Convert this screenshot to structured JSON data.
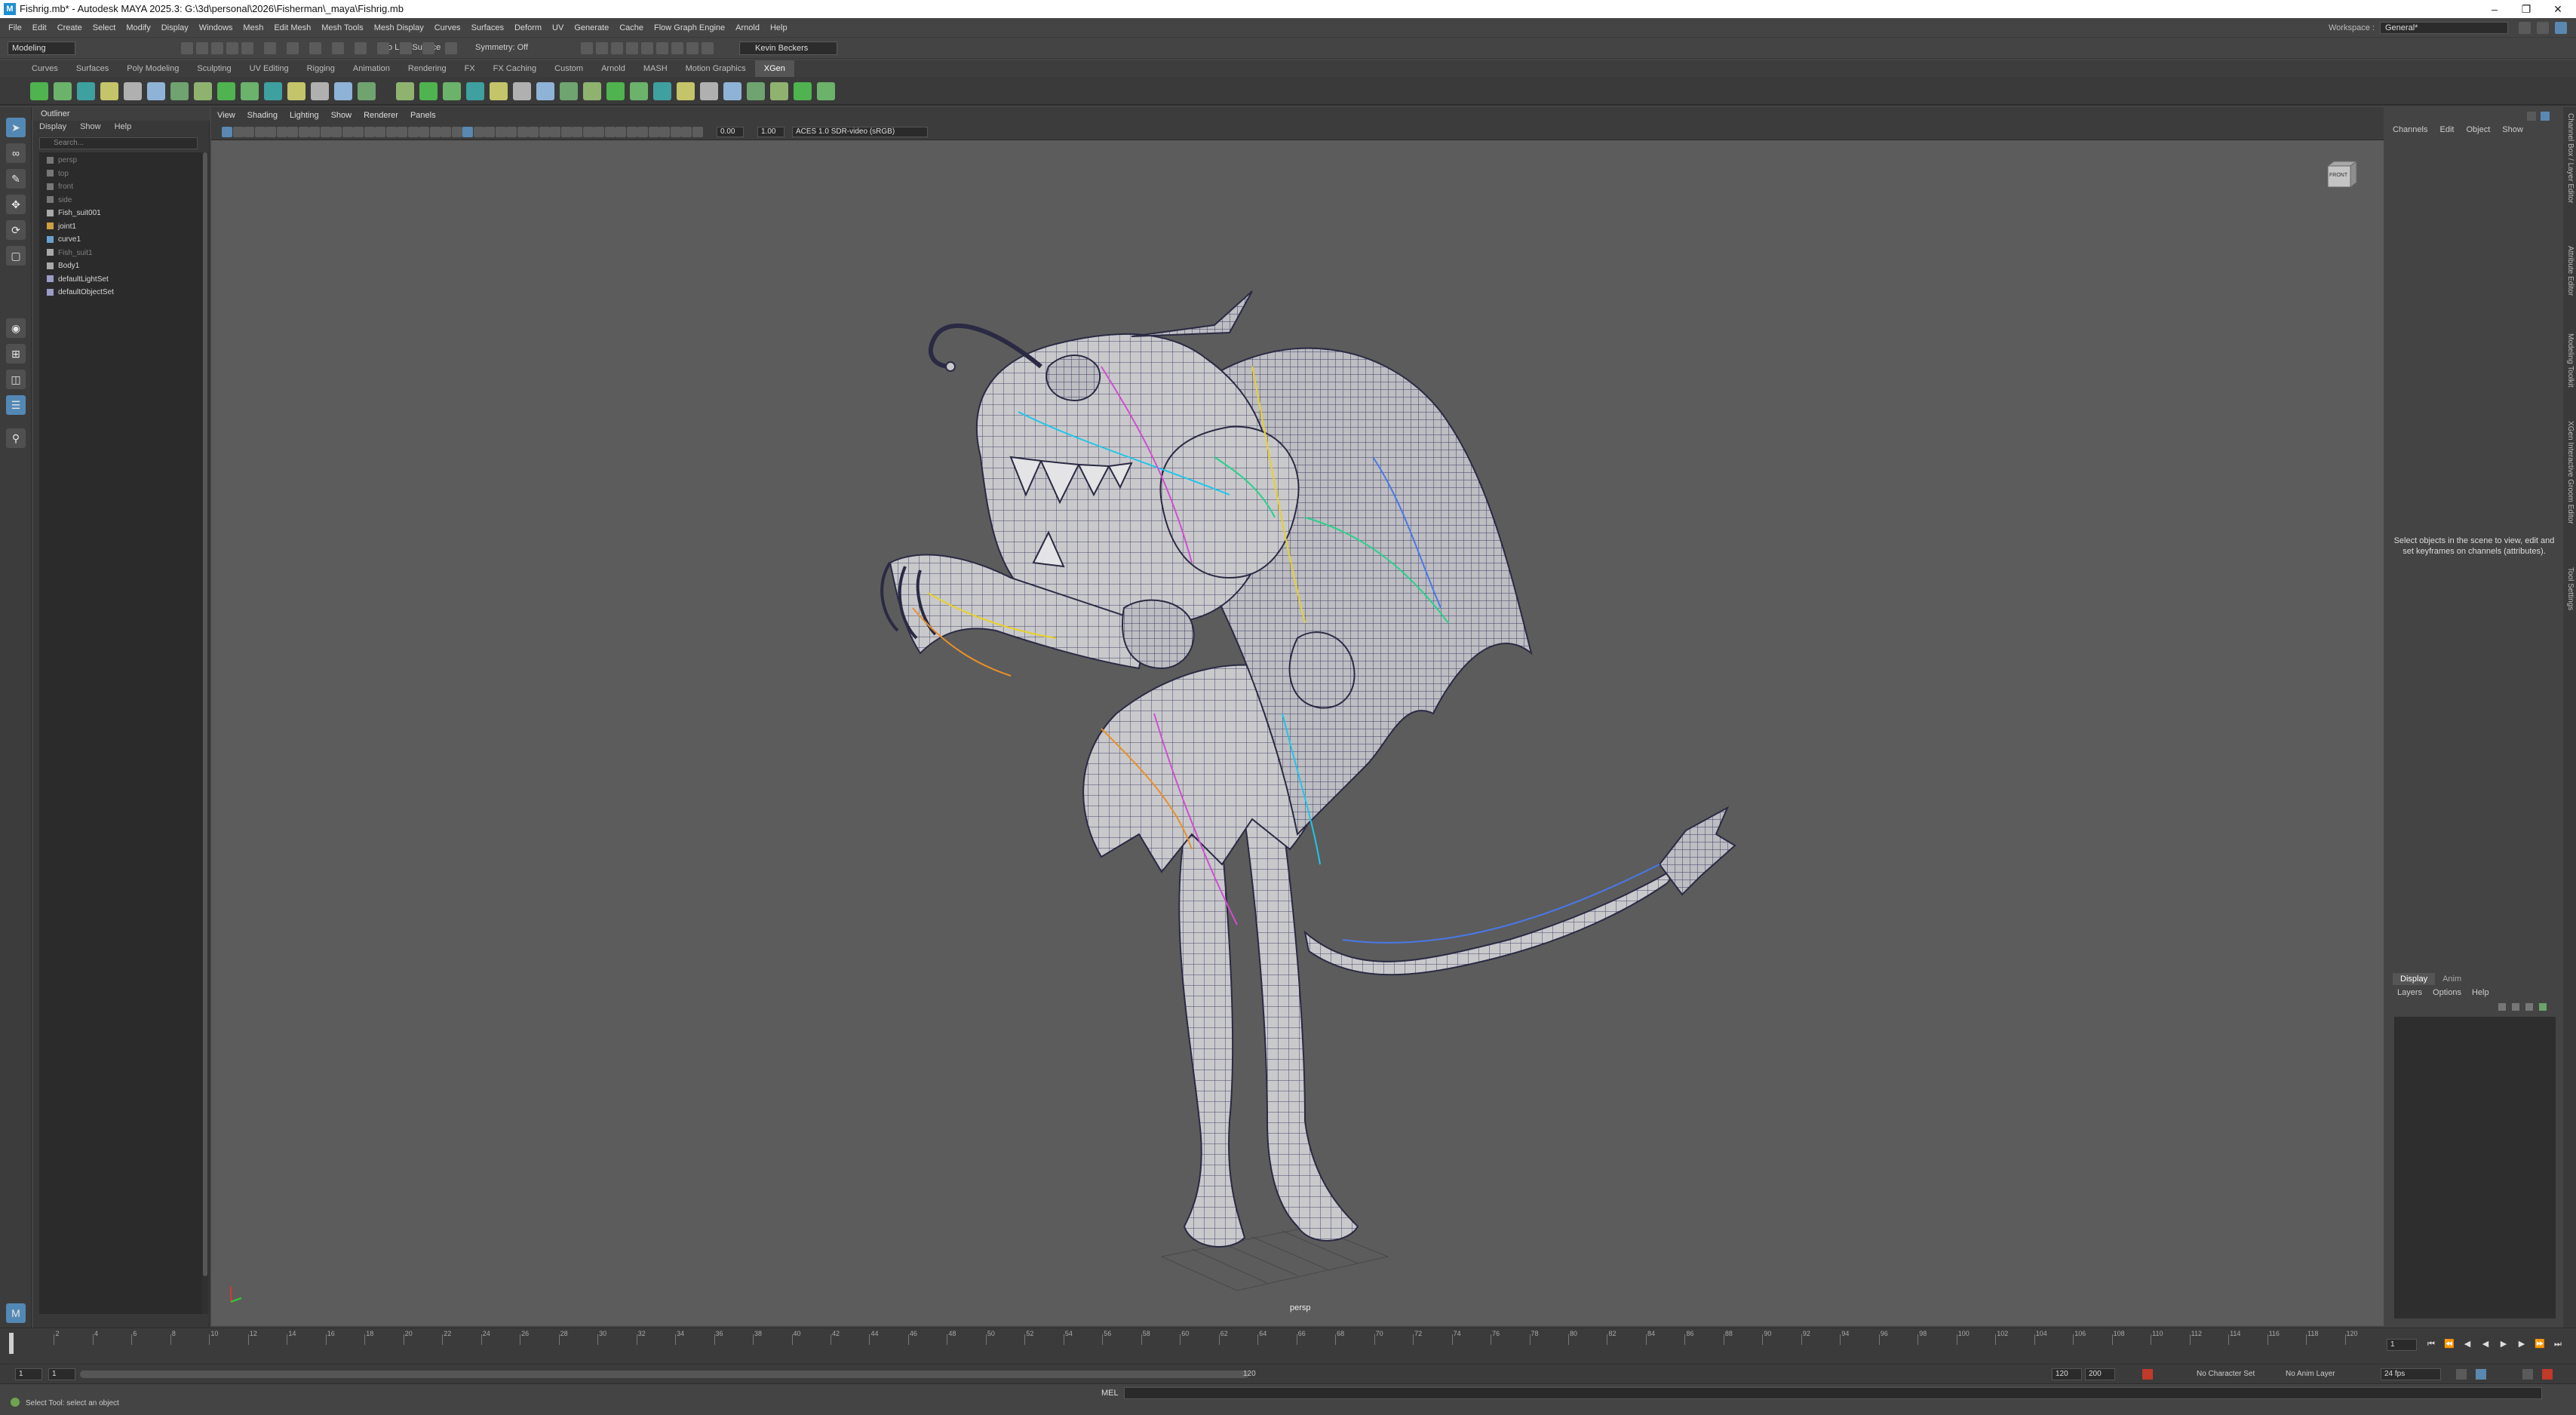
{
  "window": {
    "title": "Fishrig.mb* - Autodesk MAYA 2025.3: G:\\3d\\personal\\2026\\Fisherman\\_maya\\Fishrig.mb",
    "logo": "M",
    "minimize_icon": "minimize-icon",
    "restore_icon": "restore-icon",
    "close_icon": "close-icon"
  },
  "menubar": {
    "items": [
      "File",
      "Edit",
      "Create",
      "Select",
      "Modify",
      "Display",
      "Windows",
      "Mesh",
      "Edit Mesh",
      "Mesh Tools",
      "Mesh Display",
      "Curves",
      "Surfaces",
      "Deform",
      "UV",
      "Generate",
      "Cache",
      "Flow Graph Engine",
      "Arnold",
      "Help"
    ],
    "workspace_label": "Workspace :",
    "workspace_value": "General*"
  },
  "statusline": {
    "menuset": "Modeling",
    "live_surface": "No Live Surface",
    "symmetry": "Symmetry: Off",
    "user": "Kevin Beckers"
  },
  "shelf": {
    "tabs": [
      "Curves",
      "Surfaces",
      "Poly Modeling",
      "Sculpting",
      "UV Editing",
      "Rigging",
      "Animation",
      "Rendering",
      "FX",
      "FX Caching",
      "Custom",
      "Arnold",
      "MASH",
      "Motion Graphics",
      "XGen"
    ],
    "active_tab": "XGen"
  },
  "outliner": {
    "title": "Outliner",
    "menu": [
      "Display",
      "Show",
      "Help"
    ],
    "search_placeholder": "Search...",
    "items": [
      {
        "label": "persp",
        "dim": true,
        "icon": "camera-icon"
      },
      {
        "label": "top",
        "dim": true,
        "icon": "camera-icon"
      },
      {
        "label": "front",
        "dim": true,
        "icon": "camera-icon"
      },
      {
        "label": "side",
        "dim": true,
        "icon": "camera-icon"
      },
      {
        "label": "Fish_suit001",
        "dim": false,
        "icon": "mesh-icon"
      },
      {
        "label": "joint1",
        "dim": false,
        "icon": "joint-icon"
      },
      {
        "label": "curve1",
        "dim": false,
        "icon": "curve-icon"
      },
      {
        "label": "Fish_suit1",
        "dim": true,
        "icon": "mesh-icon"
      },
      {
        "label": "Body1",
        "dim": false,
        "icon": "mesh-icon"
      },
      {
        "label": "defaultLightSet",
        "dim": false,
        "icon": "set-icon"
      },
      {
        "label": "defaultObjectSet",
        "dim": false,
        "icon": "set-icon"
      }
    ]
  },
  "viewport": {
    "menu": [
      "View",
      "Shading",
      "Lighting",
      "Show",
      "Renderer",
      "Panels"
    ],
    "exposure": "0.00",
    "gamma": "1.00",
    "color_space": "ACES 1.0 SDR-video (sRGB)",
    "camera_label": "persp",
    "viewcube_label": "FRONT"
  },
  "channelbox": {
    "menu": [
      "Channels",
      "Edit",
      "Object",
      "Show"
    ],
    "message": "Select objects in the scene to view, edit and set keyframes on channels (attributes).",
    "layer_tabs": [
      "Display",
      "Anim"
    ],
    "layer_menu": [
      "Layers",
      "Options",
      "Help"
    ],
    "side_tabs": [
      "Channel Box / Layer Editor",
      "Attribute Editor",
      "Modeling Toolkit",
      "XGen Interactive Groom Editor",
      "Tool Settings"
    ]
  },
  "timeslider": {
    "ticks": [
      "2",
      "4",
      "6",
      "8",
      "10",
      "12",
      "14",
      "16",
      "18",
      "20",
      "22",
      "24",
      "26",
      "28",
      "30",
      "32",
      "34",
      "36",
      "38",
      "40",
      "42",
      "44",
      "46",
      "48",
      "50",
      "52",
      "54",
      "56",
      "58",
      "60",
      "62",
      "64",
      "66",
      "68",
      "70",
      "72",
      "74",
      "76",
      "78",
      "80",
      "82",
      "84",
      "86",
      "88",
      "90",
      "92",
      "94",
      "96",
      "98",
      "100",
      "102",
      "104",
      "106",
      "108",
      "110",
      "112",
      "114",
      "116",
      "118",
      "120"
    ],
    "current_frame": "1"
  },
  "rangeslider": {
    "start": "1",
    "inner_start": "1",
    "inner_end": "120",
    "end": "200",
    "character_set": "No Character Set",
    "anim_layer": "No Anim Layer",
    "fps": "24 fps"
  },
  "commandline": {
    "language": "MEL",
    "help": "Select Tool: select an object"
  },
  "colors": {
    "accent": "#5388b5",
    "viewport_bg": "#5c5c5c",
    "panel_bg": "#444444"
  }
}
